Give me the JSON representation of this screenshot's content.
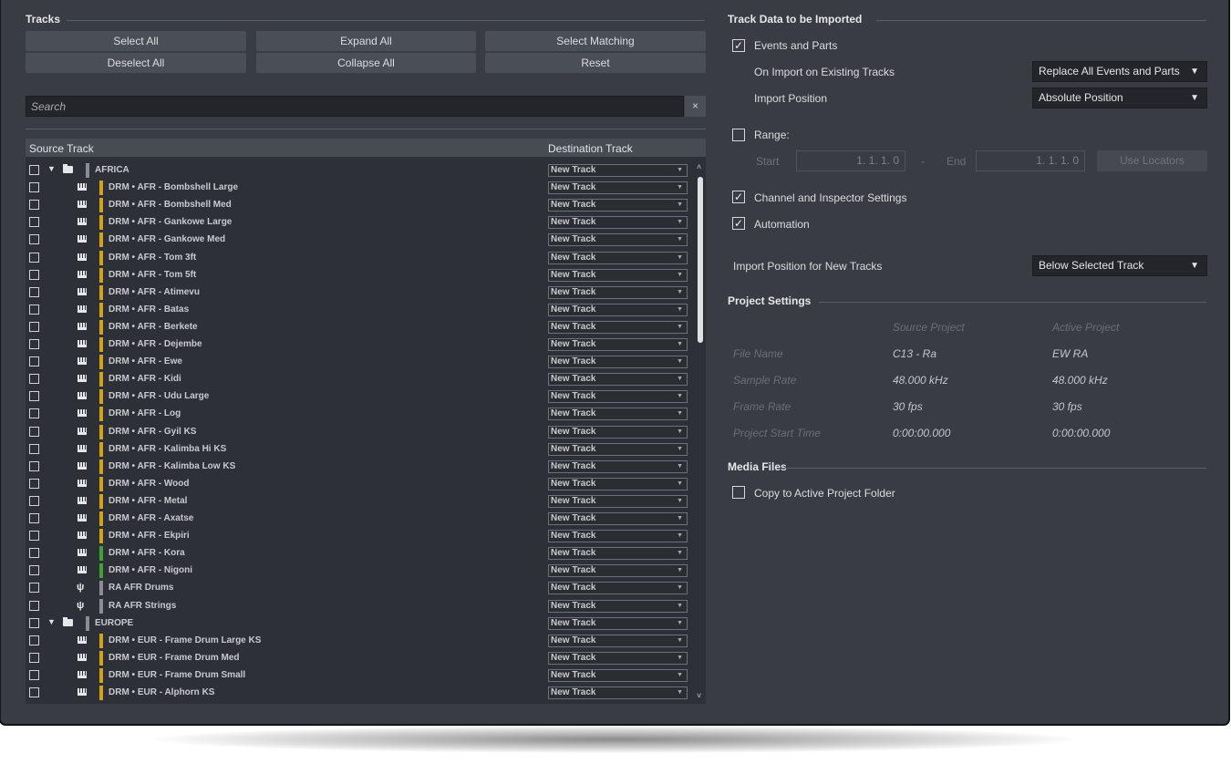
{
  "tracks_section": {
    "title": "Tracks",
    "buttons": {
      "select_all": "Select All",
      "deselect_all": "Deselect All",
      "expand_all": "Expand All",
      "collapse_all": "Collapse All",
      "select_matching": "Select Matching",
      "reset": "Reset"
    },
    "search_placeholder": "Search",
    "clear_glyph": "×",
    "columns": {
      "source": "Source Track",
      "destination": "Destination Track"
    }
  },
  "rows": [
    {
      "type": "folder",
      "name": "AFRICA",
      "dest": "New Track",
      "color": "#8a8d93"
    },
    {
      "type": "midi",
      "name": "DRM • AFR - Bombshell Large",
      "dest": "New Track",
      "color": "#d4a21a"
    },
    {
      "type": "midi",
      "name": "DRM • AFR - Bombshell Med",
      "dest": "New Track",
      "color": "#d4a21a"
    },
    {
      "type": "midi",
      "name": "DRM • AFR - Gankowe Large",
      "dest": "New Track",
      "color": "#d4a21a"
    },
    {
      "type": "midi",
      "name": "DRM • AFR - Gankowe Med",
      "dest": "New Track",
      "color": "#d4a21a"
    },
    {
      "type": "midi",
      "name": "DRM • AFR - Tom 3ft",
      "dest": "New Track",
      "color": "#d4a21a"
    },
    {
      "type": "midi",
      "name": "DRM • AFR - Tom 5ft",
      "dest": "New Track",
      "color": "#d4a21a"
    },
    {
      "type": "midi",
      "name": "DRM • AFR - Atimevu",
      "dest": "New Track",
      "color": "#d4a21a"
    },
    {
      "type": "midi",
      "name": "DRM • AFR - Batas",
      "dest": "New Track",
      "color": "#d4a21a"
    },
    {
      "type": "midi",
      "name": "DRM • AFR - Berkete",
      "dest": "New Track",
      "color": "#d4a21a"
    },
    {
      "type": "midi",
      "name": "DRM • AFR - Dejembe",
      "dest": "New Track",
      "color": "#d4a21a"
    },
    {
      "type": "midi",
      "name": "DRM • AFR - Ewe",
      "dest": "New Track",
      "color": "#d4a21a"
    },
    {
      "type": "midi",
      "name": "DRM • AFR - Kidi",
      "dest": "New Track",
      "color": "#d4a21a"
    },
    {
      "type": "midi",
      "name": "DRM • AFR - Udu Large",
      "dest": "New Track",
      "color": "#d4a21a"
    },
    {
      "type": "midi",
      "name": "DRM • AFR - Log",
      "dest": "New Track",
      "color": "#d4a21a"
    },
    {
      "type": "midi",
      "name": "DRM • AFR - Gyil KS",
      "dest": "New Track",
      "color": "#d4a21a"
    },
    {
      "type": "midi",
      "name": "DRM • AFR - Kalimba Hi KS",
      "dest": "New Track",
      "color": "#d4a21a"
    },
    {
      "type": "midi",
      "name": "DRM • AFR - Kalimba Low KS",
      "dest": "New Track",
      "color": "#d4a21a"
    },
    {
      "type": "midi",
      "name": "DRM • AFR - Wood",
      "dest": "New Track",
      "color": "#d4a21a"
    },
    {
      "type": "midi",
      "name": "DRM • AFR - Metal",
      "dest": "New Track",
      "color": "#d4a21a"
    },
    {
      "type": "midi",
      "name": "DRM • AFR - Axatse",
      "dest": "New Track",
      "color": "#d4a21a"
    },
    {
      "type": "midi",
      "name": "DRM • AFR - Ekpiri",
      "dest": "New Track",
      "color": "#d4a21a"
    },
    {
      "type": "midi",
      "name": "DRM • AFR - Kora",
      "dest": "New Track",
      "color": "#3fa33a"
    },
    {
      "type": "midi",
      "name": "DRM • AFR - Nigoni",
      "dest": "New Track",
      "color": "#3fa33a"
    },
    {
      "type": "instrument",
      "name": "RA AFR Drums",
      "dest": "New Track",
      "color": "#8a8d93"
    },
    {
      "type": "instrument",
      "name": "RA AFR Strings",
      "dest": "New Track",
      "color": "#8a8d93"
    },
    {
      "type": "folder",
      "name": "EUROPE",
      "dest": "New Track",
      "color": "#8a8d93"
    },
    {
      "type": "midi",
      "name": "DRM • EUR - Frame Drum Large KS",
      "dest": "New Track",
      "color": "#d4a21a"
    },
    {
      "type": "midi",
      "name": "DRM • EUR - Frame Drum Med",
      "dest": "New Track",
      "color": "#d4a21a"
    },
    {
      "type": "midi",
      "name": "DRM • EUR - Frame Drum Small",
      "dest": "New Track",
      "color": "#d4a21a"
    },
    {
      "type": "midi",
      "name": "DRM • EUR - Alphorn KS",
      "dest": "New Track",
      "color": "#d4a21a"
    }
  ],
  "import_section": {
    "title": "Track Data to be Imported",
    "events_parts": {
      "label": "Events and Parts",
      "checked": true
    },
    "on_import_label": "On Import on Existing Tracks",
    "on_import_value": "Replace All Events and Parts",
    "import_position_label": "Import Position",
    "import_position_value": "Absolute Position",
    "range": {
      "label": "Range:",
      "checked": false,
      "start_label": "Start",
      "start_value": "1. 1. 1.  0",
      "dash": "-",
      "end_label": "End",
      "end_value": "1. 1. 1.  0",
      "use_locators": "Use Locators"
    },
    "channel_inspector": {
      "label": "Channel and Inspector Settings",
      "checked": true
    },
    "automation": {
      "label": "Automation",
      "checked": true
    },
    "new_tracks_label": "Import Position for New Tracks",
    "new_tracks_value": "Below Selected Track",
    "dropdown_arrow": "▼",
    "check_glyph": "✓"
  },
  "project_settings": {
    "title": "Project Settings",
    "col_source": "Source Project",
    "col_active": "Active Project",
    "rows": [
      {
        "key": "File Name",
        "source": "C13 - Ra",
        "active": "EW RA"
      },
      {
        "key": "Sample Rate",
        "source": "48.000 kHz",
        "active": "48.000 kHz"
      },
      {
        "key": "Frame Rate",
        "source": "30 fps",
        "active": "30 fps"
      },
      {
        "key": "Project Start Time",
        "source": "0:00:00.000",
        "active": "0:00:00.000"
      }
    ]
  },
  "media_files": {
    "title": "Media Files",
    "copy": {
      "label": "Copy to Active Project Folder",
      "checked": false
    }
  }
}
